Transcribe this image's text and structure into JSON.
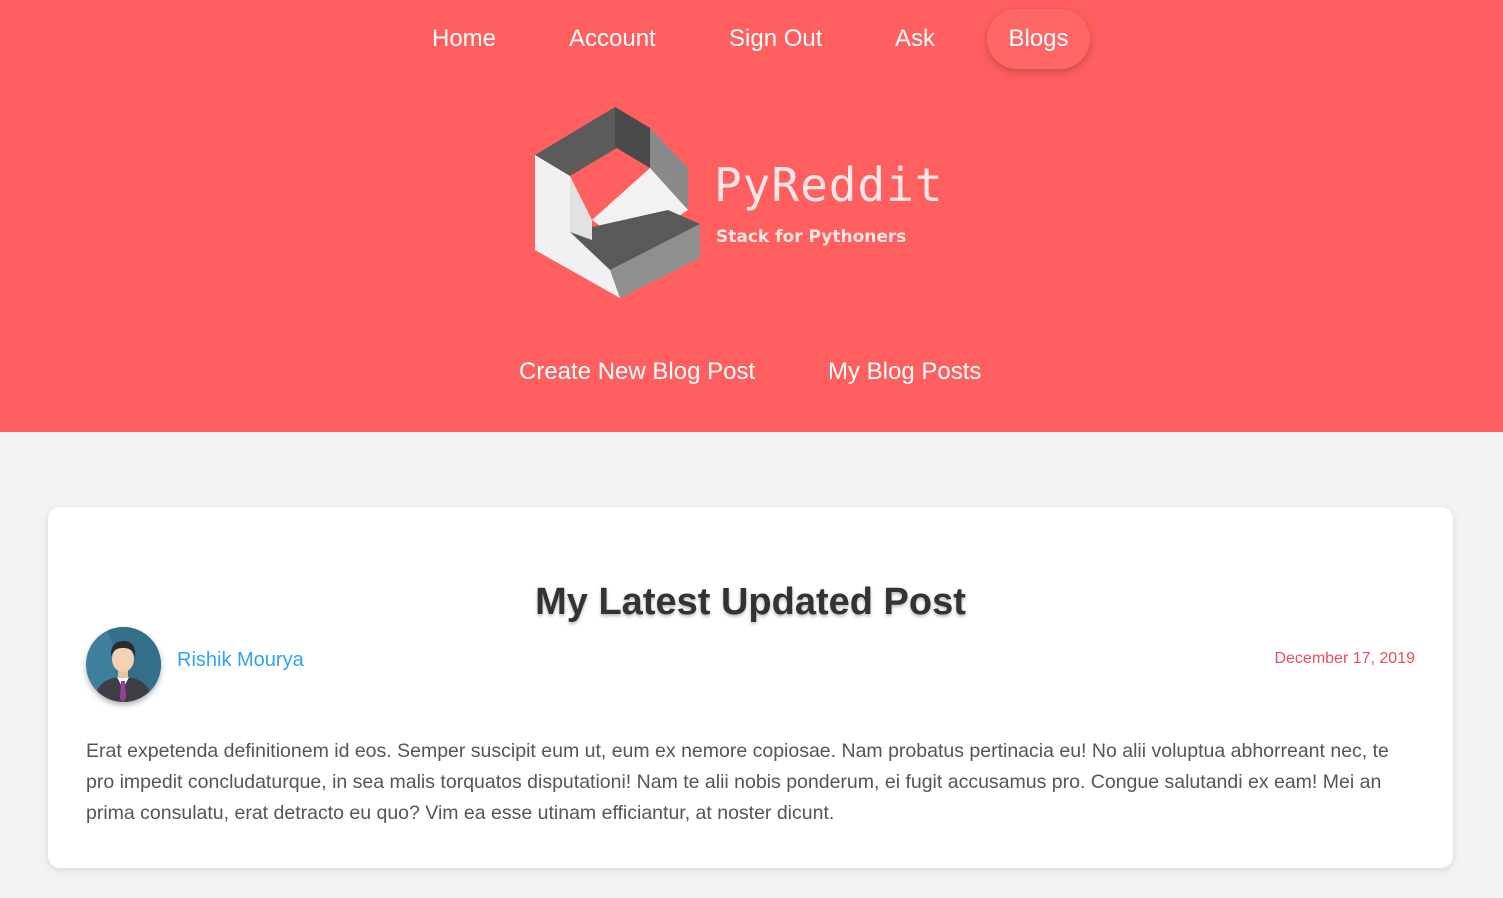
{
  "nav": {
    "items": [
      {
        "label": "Home"
      },
      {
        "label": "Account"
      },
      {
        "label": "Sign Out"
      },
      {
        "label": "Ask"
      },
      {
        "label": "Blogs"
      }
    ],
    "active": "Blogs"
  },
  "logo": {
    "title": "PyReddit",
    "subtitle": "Stack for Pythoners",
    "icon": "isometric-cube-logo-icon"
  },
  "subnav": {
    "create_label": "Create New Blog Post",
    "mine_label": "My Blog Posts"
  },
  "post": {
    "title": "My Latest Updated Post",
    "author": "Rishik Mourya",
    "date": "December 17, 2019",
    "body": "Erat expetenda definitionem id eos. Semper suscipit eum ut, eum ex nemore copiosae. Nam probatus pertinacia eu! No alii voluptua abhorreant nec, te pro impedit concludaturque, in sea malis torquatos disputationi! Nam te alii nobis ponderum, ei fugit accusamus pro. Congue salutandi ex eam! Mei an prima consulatu, erat detracto eu quo? Vim ea esse utinam efficiantur, at noster dicunt."
  },
  "colors": {
    "header_bg": "#ff5f5f",
    "page_bg": "#f3f3f3",
    "author_link": "#2ea3f2",
    "date": "#e84d5b",
    "title": "#333333"
  }
}
